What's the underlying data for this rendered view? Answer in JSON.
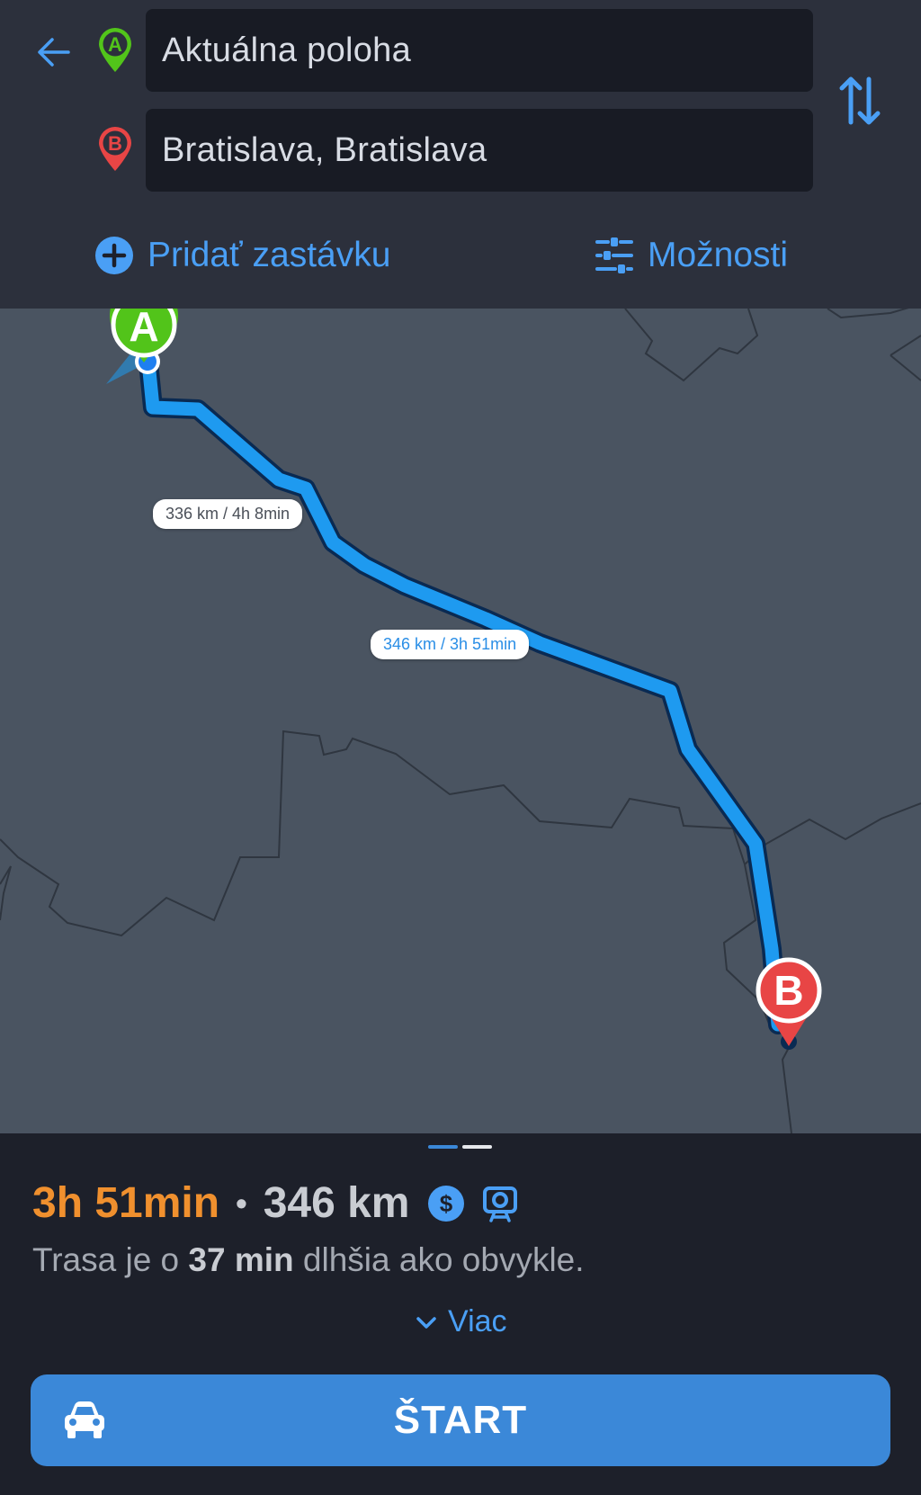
{
  "header": {
    "origin_value": "Aktuálna poloha",
    "destination_value": "Bratislava, Bratislava",
    "origin_marker": "A",
    "destination_marker": "B",
    "add_stop_label": "Pridať zastávku",
    "options_label": "Možnosti",
    "icons": {
      "back": "arrow-left-icon",
      "swap": "swap-vertical-icon",
      "add_stop": "plus-circle-icon",
      "options": "sliders-icon"
    }
  },
  "map": {
    "origin_marker": "A",
    "destination_marker": "B",
    "routes": [
      {
        "label": "336 km / 4h 8min",
        "selected": false
      },
      {
        "label": "346 km / 3h 51min",
        "selected": true
      }
    ]
  },
  "summary": {
    "duration": "3h 51min",
    "separator": "•",
    "distance": "346 km",
    "icons": [
      "toll-dollar-icon",
      "speed-camera-icon"
    ],
    "note_prefix": "Trasa je o ",
    "note_bold": "37 min",
    "note_suffix": " dlhšia ako obvykle.",
    "more_label": "Viac",
    "start_label": "ŠTART"
  },
  "colors": {
    "accent": "#4a9ff5",
    "duration": "#f0902e",
    "route": "#1e9af0",
    "origin_pin": "#52c41a",
    "destination_pin": "#e84545",
    "start_button": "#3b88d8",
    "map_background": "#4a5461"
  }
}
